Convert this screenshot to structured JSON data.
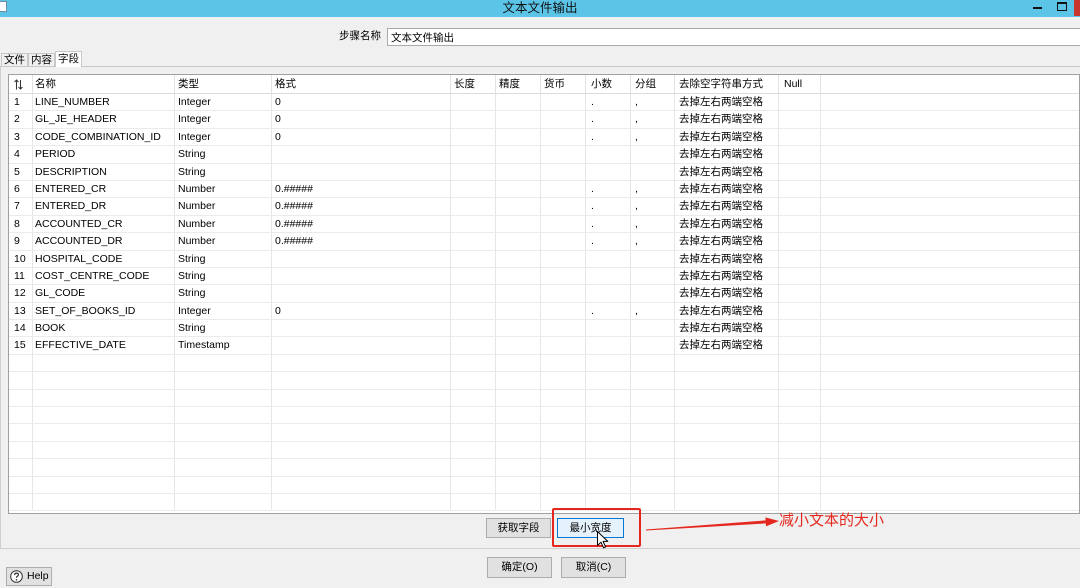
{
  "window": {
    "title": "文本文件输出"
  },
  "colors": {
    "titlebar": "#5cc4e7",
    "close_button": "#c8372f",
    "annotation": "#e5281f",
    "focus_border": "#0078d7"
  },
  "icons": {
    "app": "app-icon",
    "index_header": "sort-icon",
    "help": "help-icon",
    "pointer": "mouse-cursor",
    "annotation_arrow": "arrow-icon"
  },
  "step_name": {
    "label": "步骤名称",
    "value": "文本文件输出"
  },
  "tabs": [
    {
      "label": "文件",
      "selected": false
    },
    {
      "label": "内容",
      "selected": false
    },
    {
      "label": "字段",
      "selected": true
    }
  ],
  "table": {
    "columns": [
      "名称",
      "类型",
      "格式",
      "长度",
      "精度",
      "货币",
      "小数",
      "分组",
      "去除空字符串方式",
      "Null"
    ],
    "rows": [
      [
        "1",
        "LINE_NUMBER",
        "Integer",
        "0",
        "",
        "",
        "",
        ".",
        ",",
        "去掉左右两端空格",
        ""
      ],
      [
        "2",
        "GL_JE_HEADER",
        "Integer",
        "0",
        "",
        "",
        "",
        ".",
        ",",
        "去掉左右两端空格",
        ""
      ],
      [
        "3",
        "CODE_COMBINATION_ID",
        "Integer",
        "0",
        "",
        "",
        "",
        ".",
        ",",
        "去掉左右两端空格",
        ""
      ],
      [
        "4",
        "PERIOD",
        "String",
        "",
        "",
        "",
        "",
        "",
        "",
        "去掉左右两端空格",
        ""
      ],
      [
        "5",
        "DESCRIPTION",
        "String",
        "",
        "",
        "",
        "",
        "",
        "",
        "去掉左右两端空格",
        ""
      ],
      [
        "6",
        "ENTERED_CR",
        "Number",
        "0.#####",
        "",
        "",
        "",
        ".",
        ",",
        "去掉左右两端空格",
        ""
      ],
      [
        "7",
        "ENTERED_DR",
        "Number",
        "0.#####",
        "",
        "",
        "",
        ".",
        ",",
        "去掉左右两端空格",
        ""
      ],
      [
        "8",
        "ACCOUNTED_CR",
        "Number",
        "0.#####",
        "",
        "",
        "",
        ".",
        ",",
        "去掉左右两端空格",
        ""
      ],
      [
        "9",
        "ACCOUNTED_DR",
        "Number",
        "0.#####",
        "",
        "",
        "",
        ".",
        ",",
        "去掉左右两端空格",
        ""
      ],
      [
        "10",
        "HOSPITAL_CODE",
        "String",
        "",
        "",
        "",
        "",
        "",
        "",
        "去掉左右两端空格",
        ""
      ],
      [
        "11",
        "COST_CENTRE_CODE",
        "String",
        "",
        "",
        "",
        "",
        "",
        "",
        "去掉左右两端空格",
        ""
      ],
      [
        "12",
        "GL_CODE",
        "String",
        "",
        "",
        "",
        "",
        "",
        "",
        "去掉左右两端空格",
        ""
      ],
      [
        "13",
        "SET_OF_BOOKS_ID",
        "Integer",
        "0",
        "",
        "",
        "",
        ".",
        ",",
        "去掉左右两端空格",
        ""
      ],
      [
        "14",
        "BOOK",
        "String",
        "",
        "",
        "",
        "",
        "",
        "",
        "去掉左右两端空格",
        ""
      ],
      [
        "15",
        "EFFECTIVE_DATE",
        "Timestamp",
        "",
        "",
        "",
        "",
        "",
        "",
        "去掉左右两端空格",
        ""
      ]
    ]
  },
  "buttons": {
    "get_fields": "获取字段",
    "min_width": "最小宽度",
    "ok": "确定(O)",
    "cancel": "取消(C)",
    "help": "Help"
  },
  "annotation": {
    "text": "减小文本的大小"
  }
}
